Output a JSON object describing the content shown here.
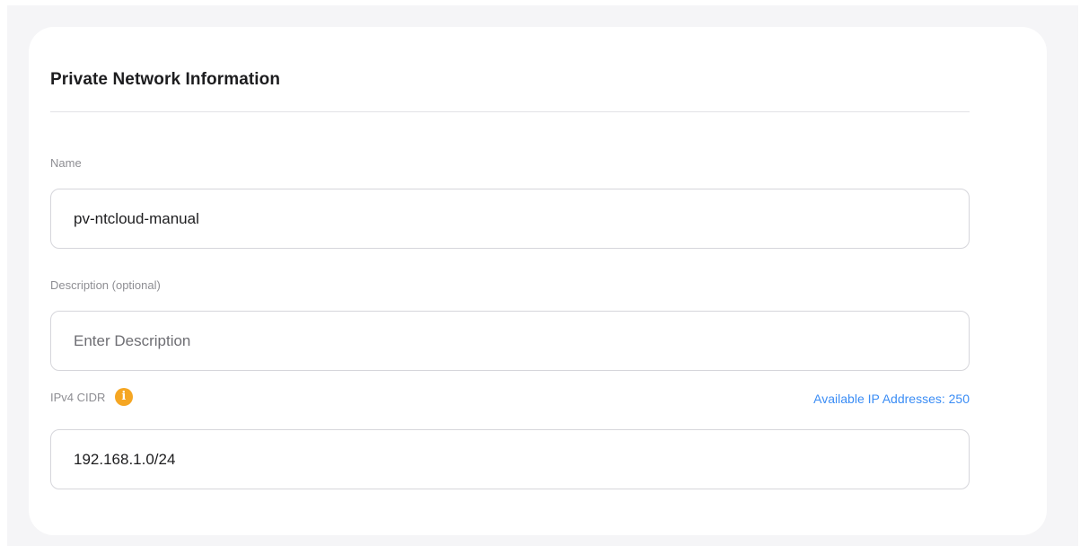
{
  "section": {
    "title": "Private Network Information"
  },
  "fields": {
    "name": {
      "label": "Name",
      "value": "pv-ntcloud-manual"
    },
    "description": {
      "label": "Description (optional)",
      "placeholder": "Enter Description",
      "value": ""
    },
    "cidr": {
      "label": "IPv4 CIDR",
      "info_icon": "i",
      "value": "192.168.1.0/24",
      "available_text": "Available IP Addresses: 250"
    }
  },
  "colors": {
    "page_background": "#f5f5f7",
    "card_background": "#ffffff",
    "info_icon": "#f5a623",
    "link_blue": "#3b8df5",
    "label_gray": "#8e8e93",
    "border": "#d6d6db"
  }
}
